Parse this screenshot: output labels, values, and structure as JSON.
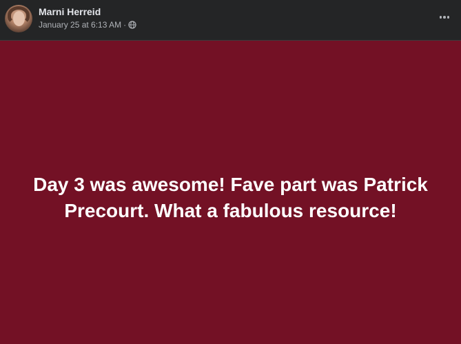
{
  "post": {
    "author": "Marni Herreid",
    "date": "January 25 at 6:13 AM",
    "separator": "·",
    "audience_icon": "globe-icon",
    "more_icon": "more-options-icon",
    "text": "Day 3 was awesome! Fave part was Patrick Precourt. What a fabulous resource!",
    "background_color": "#731125",
    "text_color": "#ffffff"
  }
}
